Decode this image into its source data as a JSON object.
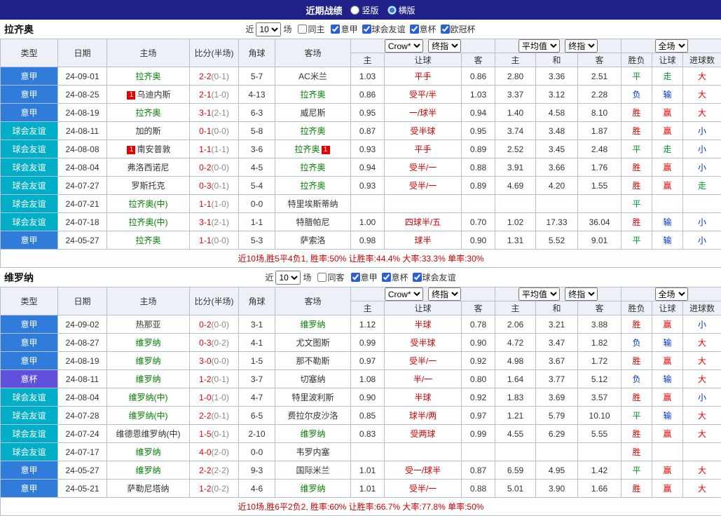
{
  "header": {
    "title": "近期战绩",
    "vertical_label": "竖版",
    "horizontal_label": "横版",
    "selected_layout": "横版"
  },
  "table_headers": {
    "main": [
      "类型",
      "日期",
      "主场",
      "比分(半场)",
      "角球",
      "客场"
    ],
    "sub": [
      "主",
      "让球",
      "客",
      "主",
      "和",
      "客",
      "胜负",
      "让球",
      "进球数"
    ]
  },
  "league_colors": {
    "意甲": "#2f7cdb",
    "球会友谊": "#00aec8",
    "意杯": "#6150dc",
    "欧冠杯": "#9b30d0"
  },
  "sections": [
    {
      "team": "拉齐奥",
      "filter": {
        "near": "近",
        "count": "10",
        "unit": "场",
        "same_label": "同主",
        "same_checked": false,
        "leagues": [
          {
            "label": "意甲",
            "checked": true
          },
          {
            "label": "球会友谊",
            "checked": true
          },
          {
            "label": "意杯",
            "checked": true
          },
          {
            "label": "欧冠杯",
            "checked": true
          }
        ]
      },
      "selects": {
        "company": "Crow*",
        "company_mode": "终指",
        "average": "平均值",
        "average_mode": "终指",
        "scope": "全场"
      },
      "rows": [
        {
          "lg": "意甲",
          "date": "24-09-01",
          "home": "拉齐奥",
          "home_hl": true,
          "home_badge": "",
          "score": "2-2",
          "half": "(0-1)",
          "corner": "5-7",
          "away": "AC米兰",
          "away_hl": false,
          "away_badge": "",
          "odds": [
            "1.03",
            "平手",
            "0.86"
          ],
          "avg": [
            "2.80",
            "3.36",
            "2.51"
          ],
          "res": [
            "平",
            "走",
            "大"
          ]
        },
        {
          "lg": "意甲",
          "date": "24-08-25",
          "home": "乌迪内斯",
          "home_hl": false,
          "home_badge": "1",
          "score": "2-1",
          "half": "(1-0)",
          "corner": "4-13",
          "away": "拉齐奥",
          "away_hl": true,
          "away_badge": "",
          "odds": [
            "0.86",
            "受平/半",
            "1.03"
          ],
          "avg": [
            "3.37",
            "3.12",
            "2.28"
          ],
          "res": [
            "负",
            "输",
            "大"
          ]
        },
        {
          "lg": "意甲",
          "date": "24-08-19",
          "home": "拉齐奥",
          "home_hl": true,
          "home_badge": "",
          "score": "3-1",
          "half": "(2-1)",
          "corner": "6-3",
          "away": "威尼斯",
          "away_hl": false,
          "away_badge": "",
          "odds": [
            "0.95",
            "一/球半",
            "0.94"
          ],
          "avg": [
            "1.40",
            "4.58",
            "8.10"
          ],
          "res": [
            "胜",
            "赢",
            "大"
          ]
        },
        {
          "lg": "球会友谊",
          "date": "24-08-11",
          "home": "加的斯",
          "home_hl": false,
          "home_badge": "",
          "score": "0-1",
          "half": "(0-0)",
          "corner": "5-8",
          "away": "拉齐奥",
          "away_hl": true,
          "away_badge": "",
          "odds": [
            "0.87",
            "受半球",
            "0.95"
          ],
          "avg": [
            "3.74",
            "3.48",
            "1.87"
          ],
          "res": [
            "胜",
            "赢",
            "小"
          ]
        },
        {
          "lg": "球会友谊",
          "date": "24-08-08",
          "home": "南安普敦",
          "home_hl": false,
          "home_badge": "1",
          "score": "1-1",
          "half": "(1-1)",
          "corner": "3-6",
          "away": "拉齐奥",
          "away_hl": true,
          "away_badge": "1",
          "odds": [
            "0.93",
            "平手",
            "0.89"
          ],
          "avg": [
            "2.52",
            "3.45",
            "2.48"
          ],
          "res": [
            "平",
            "走",
            "小"
          ]
        },
        {
          "lg": "球会友谊",
          "date": "24-08-04",
          "home": "弗洛西诺尼",
          "home_hl": false,
          "home_badge": "",
          "score": "0-2",
          "half": "(0-0)",
          "corner": "4-5",
          "away": "拉齐奥",
          "away_hl": true,
          "away_badge": "",
          "odds": [
            "0.94",
            "受半/一",
            "0.88"
          ],
          "avg": [
            "3.91",
            "3.66",
            "1.76"
          ],
          "res": [
            "胜",
            "赢",
            "小"
          ]
        },
        {
          "lg": "球会友谊",
          "date": "24-07-27",
          "home": "罗斯托克",
          "home_hl": false,
          "home_badge": "",
          "score": "0-3",
          "half": "(0-1)",
          "corner": "5-4",
          "away": "拉齐奥",
          "away_hl": true,
          "away_badge": "",
          "odds": [
            "0.93",
            "受半/一",
            "0.89"
          ],
          "avg": [
            "4.69",
            "4.20",
            "1.55"
          ],
          "res": [
            "胜",
            "赢",
            "走"
          ]
        },
        {
          "lg": "球会友谊",
          "date": "24-07-21",
          "home": "拉齐奥(中)",
          "home_hl": true,
          "home_badge": "",
          "score": "1-1",
          "half": "(1-0)",
          "corner": "0-0",
          "away": "特里埃斯蒂纳",
          "away_hl": false,
          "away_badge": "",
          "odds": [
            "",
            "",
            ""
          ],
          "avg": [
            "",
            "",
            ""
          ],
          "res": [
            "平",
            "",
            ""
          ]
        },
        {
          "lg": "球会友谊",
          "date": "24-07-18",
          "home": "拉齐奥(中)",
          "home_hl": true,
          "home_badge": "",
          "score": "3-1",
          "half": "(2-1)",
          "corner": "1-1",
          "away": "特腊帕尼",
          "away_hl": false,
          "away_badge": "",
          "odds": [
            "1.00",
            "四球半/五",
            "0.70"
          ],
          "avg": [
            "1.02",
            "17.33",
            "36.04"
          ],
          "res": [
            "胜",
            "输",
            "小"
          ]
        },
        {
          "lg": "意甲",
          "date": "24-05-27",
          "home": "拉齐奥",
          "home_hl": true,
          "home_badge": "",
          "score": "1-1",
          "half": "(0-0)",
          "corner": "5-3",
          "away": "萨索洛",
          "away_hl": false,
          "away_badge": "",
          "odds": [
            "0.98",
            "球半",
            "0.90"
          ],
          "avg": [
            "1.31",
            "5.52",
            "9.01"
          ],
          "res": [
            "平",
            "输",
            "小"
          ]
        }
      ],
      "summary": "近10场,胜5平4负1, 胜率:50% 让胜率:44.4% 大率:33.3% 单率:30%"
    },
    {
      "team": "维罗纳",
      "filter": {
        "near": "近",
        "count": "10",
        "unit": "场",
        "same_label": "同客",
        "same_checked": false,
        "leagues": [
          {
            "label": "意甲",
            "checked": true
          },
          {
            "label": "意杯",
            "checked": true
          },
          {
            "label": "球会友谊",
            "checked": true
          }
        ]
      },
      "selects": {
        "company": "Crow*",
        "company_mode": "终指",
        "average": "平均值",
        "average_mode": "终指",
        "scope": "全场"
      },
      "rows": [
        {
          "lg": "意甲",
          "date": "24-09-02",
          "home": "热那亚",
          "home_hl": false,
          "home_badge": "",
          "score": "0-2",
          "half": "(0-0)",
          "corner": "3-1",
          "away": "维罗纳",
          "away_hl": true,
          "away_badge": "",
          "odds": [
            "1.12",
            "半球",
            "0.78"
          ],
          "avg": [
            "2.06",
            "3.21",
            "3.88"
          ],
          "res": [
            "胜",
            "赢",
            "小"
          ]
        },
        {
          "lg": "意甲",
          "date": "24-08-27",
          "home": "维罗纳",
          "home_hl": true,
          "home_badge": "",
          "score": "0-3",
          "half": "(0-2)",
          "corner": "4-1",
          "away": "尤文图斯",
          "away_hl": false,
          "away_badge": "",
          "odds": [
            "0.99",
            "受半球",
            "0.90"
          ],
          "avg": [
            "4.72",
            "3.47",
            "1.82"
          ],
          "res": [
            "负",
            "输",
            "大"
          ]
        },
        {
          "lg": "意甲",
          "date": "24-08-19",
          "home": "维罗纳",
          "home_hl": true,
          "home_badge": "",
          "score": "3-0",
          "half": "(0-0)",
          "corner": "1-5",
          "away": "那不勒斯",
          "away_hl": false,
          "away_badge": "",
          "odds": [
            "0.97",
            "受半/一",
            "0.92"
          ],
          "avg": [
            "4.98",
            "3.67",
            "1.72"
          ],
          "res": [
            "胜",
            "赢",
            "大"
          ]
        },
        {
          "lg": "意杯",
          "date": "24-08-11",
          "home": "维罗纳",
          "home_hl": true,
          "home_badge": "",
          "score": "1-2",
          "half": "(0-1)",
          "corner": "3-7",
          "away": "切塞纳",
          "away_hl": false,
          "away_badge": "",
          "odds": [
            "1.08",
            "半/一",
            "0.80"
          ],
          "avg": [
            "1.64",
            "3.77",
            "5.12"
          ],
          "res": [
            "负",
            "输",
            "大"
          ]
        },
        {
          "lg": "球会友谊",
          "date": "24-08-04",
          "home": "维罗纳(中)",
          "home_hl": true,
          "home_badge": "",
          "score": "1-0",
          "half": "(1-0)",
          "corner": "4-7",
          "away": "特里波利斯",
          "away_hl": false,
          "away_badge": "",
          "odds": [
            "0.90",
            "半球",
            "0.92"
          ],
          "avg": [
            "1.83",
            "3.69",
            "3.57"
          ],
          "res": [
            "胜",
            "赢",
            "小"
          ]
        },
        {
          "lg": "球会友谊",
          "date": "24-07-28",
          "home": "维罗纳(中)",
          "home_hl": true,
          "home_badge": "",
          "score": "2-2",
          "half": "(0-1)",
          "corner": "6-5",
          "away": "费拉尔皮沙洛",
          "away_hl": false,
          "away_badge": "",
          "odds": [
            "0.85",
            "球半/两",
            "0.97"
          ],
          "avg": [
            "1.21",
            "5.79",
            "10.10"
          ],
          "res": [
            "平",
            "输",
            "大"
          ]
        },
        {
          "lg": "球会友谊",
          "date": "24-07-24",
          "home": "维德恩维罗纳(中)",
          "home_hl": false,
          "home_badge": "",
          "score": "1-5",
          "half": "(0-1)",
          "corner": "2-10",
          "away": "维罗纳",
          "away_hl": true,
          "away_badge": "",
          "odds": [
            "0.83",
            "受两球",
            "0.99"
          ],
          "avg": [
            "4.55",
            "6.29",
            "5.55"
          ],
          "res": [
            "胜",
            "赢",
            "大"
          ]
        },
        {
          "lg": "球会友谊",
          "date": "24-07-17",
          "home": "维罗纳",
          "home_hl": true,
          "home_badge": "",
          "score": "4-0",
          "half": "(2-0)",
          "corner": "0-0",
          "away": "韦罗内塞",
          "away_hl": false,
          "away_badge": "",
          "odds": [
            "",
            "",
            ""
          ],
          "avg": [
            "",
            "",
            ""
          ],
          "res": [
            "胜",
            "",
            ""
          ]
        },
        {
          "lg": "意甲",
          "date": "24-05-27",
          "home": "维罗纳",
          "home_hl": true,
          "home_badge": "",
          "score": "2-2",
          "half": "(2-2)",
          "corner": "9-3",
          "away": "国际米兰",
          "away_hl": false,
          "away_badge": "",
          "odds": [
            "1.01",
            "受一/球半",
            "0.87"
          ],
          "avg": [
            "6.59",
            "4.95",
            "1.42"
          ],
          "res": [
            "平",
            "赢",
            "大"
          ]
        },
        {
          "lg": "意甲",
          "date": "24-05-21",
          "home": "萨勒尼塔纳",
          "home_hl": false,
          "home_badge": "",
          "score": "1-2",
          "half": "(0-2)",
          "corner": "4-6",
          "away": "维罗纳",
          "away_hl": true,
          "away_badge": "",
          "odds": [
            "1.01",
            "受半/一",
            "0.88"
          ],
          "avg": [
            "5.01",
            "3.90",
            "1.66"
          ],
          "res": [
            "胜",
            "赢",
            "大"
          ]
        }
      ],
      "summary": "近10场,胜6平2负2, 胜率:60% 让胜率:66.7% 大率:77.8% 单率:50%"
    }
  ]
}
